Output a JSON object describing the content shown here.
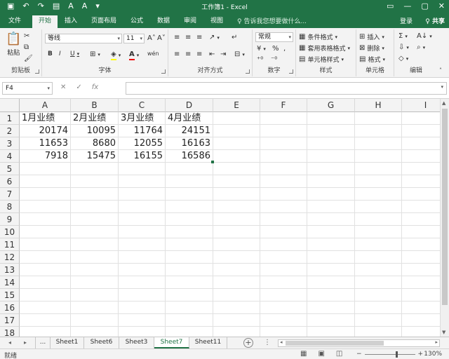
{
  "window": {
    "title": "工作簿1 - Excel",
    "accent": "#217346"
  },
  "qat": {
    "save": "▣",
    "undo": "↶",
    "redo": "↷",
    "print": "▤",
    "font_a1": "A",
    "font_a2": "A",
    "more": "▾"
  },
  "window_controls": {
    "restore": "▭",
    "minimize": "—",
    "maximize": "▢",
    "close": "✕"
  },
  "tabs": [
    {
      "label": "文件"
    },
    {
      "label": "开始"
    },
    {
      "label": "插入"
    },
    {
      "label": "页面布局"
    },
    {
      "label": "公式"
    },
    {
      "label": "数据"
    },
    {
      "label": "审阅"
    },
    {
      "label": "视图"
    }
  ],
  "tellme": "♀ 告诉我您想要做什么...",
  "account": {
    "login": "登录",
    "share": "♀ 共享"
  },
  "ribbon": {
    "clipboard": {
      "label": "剪贴板",
      "paste": "粘贴",
      "cut_icon": "✂",
      "copy_icon": "⧉",
      "painter_icon": "🖌"
    },
    "font": {
      "label": "字体",
      "font_name": "等线",
      "font_size": "11",
      "grow": "A˄",
      "shrink": "A˅",
      "bold": "B",
      "italic": "I",
      "underline": "U",
      "border": "⊞",
      "fill": "◈",
      "color": "A",
      "wen": "wén"
    },
    "align": {
      "label": "对齐方式"
    },
    "number": {
      "label": "数字",
      "format": "常规",
      "currency": "¥",
      "percent": "%",
      "comma": ","
    },
    "styles": {
      "label": "样式",
      "conditional": "条件格式",
      "as_table": "套用表格格式",
      "cell_styles": "单元格样式"
    },
    "cells": {
      "label": "单元格",
      "insert": "插入",
      "delete": "删除",
      "format": "格式"
    },
    "editing": {
      "label": "编辑",
      "sum": "Σ",
      "sort": "A↓",
      "fill": "⇩",
      "find": "⌕",
      "clear": "◇"
    }
  },
  "formula_bar": {
    "name_box": "F4",
    "cancel": "✕",
    "enter": "✓",
    "fx": "fx",
    "value": ""
  },
  "grid": {
    "columns": [
      "A",
      "B",
      "C",
      "D",
      "E",
      "F",
      "G",
      "H",
      "I"
    ],
    "rows": [
      "1",
      "2",
      "3",
      "4",
      "5",
      "6",
      "7",
      "8",
      "9",
      "10",
      "11",
      "12",
      "13",
      "14",
      "15",
      "16",
      "17",
      "18"
    ],
    "cells": [
      [
        "1月业绩",
        "2月业绩",
        "3月业绩",
        "4月业绩"
      ],
      [
        "20174",
        "10095",
        "11764",
        "24151"
      ],
      [
        "11653",
        "8680",
        "12055",
        "16163"
      ],
      [
        "7918",
        "15475",
        "16155",
        "16586"
      ]
    ]
  },
  "sheets": {
    "nav_prev": "◂",
    "nav_next": "▸",
    "ellipsis": "...",
    "tabs": [
      "Sheet1",
      "Sheet6",
      "Sheet3",
      "Sheet7",
      "Sheet11"
    ],
    "active": "Sheet7",
    "add": "+"
  },
  "status": {
    "ready": "就绪",
    "zoom": "130%",
    "zoom_minus": "−",
    "zoom_plus": "+"
  }
}
